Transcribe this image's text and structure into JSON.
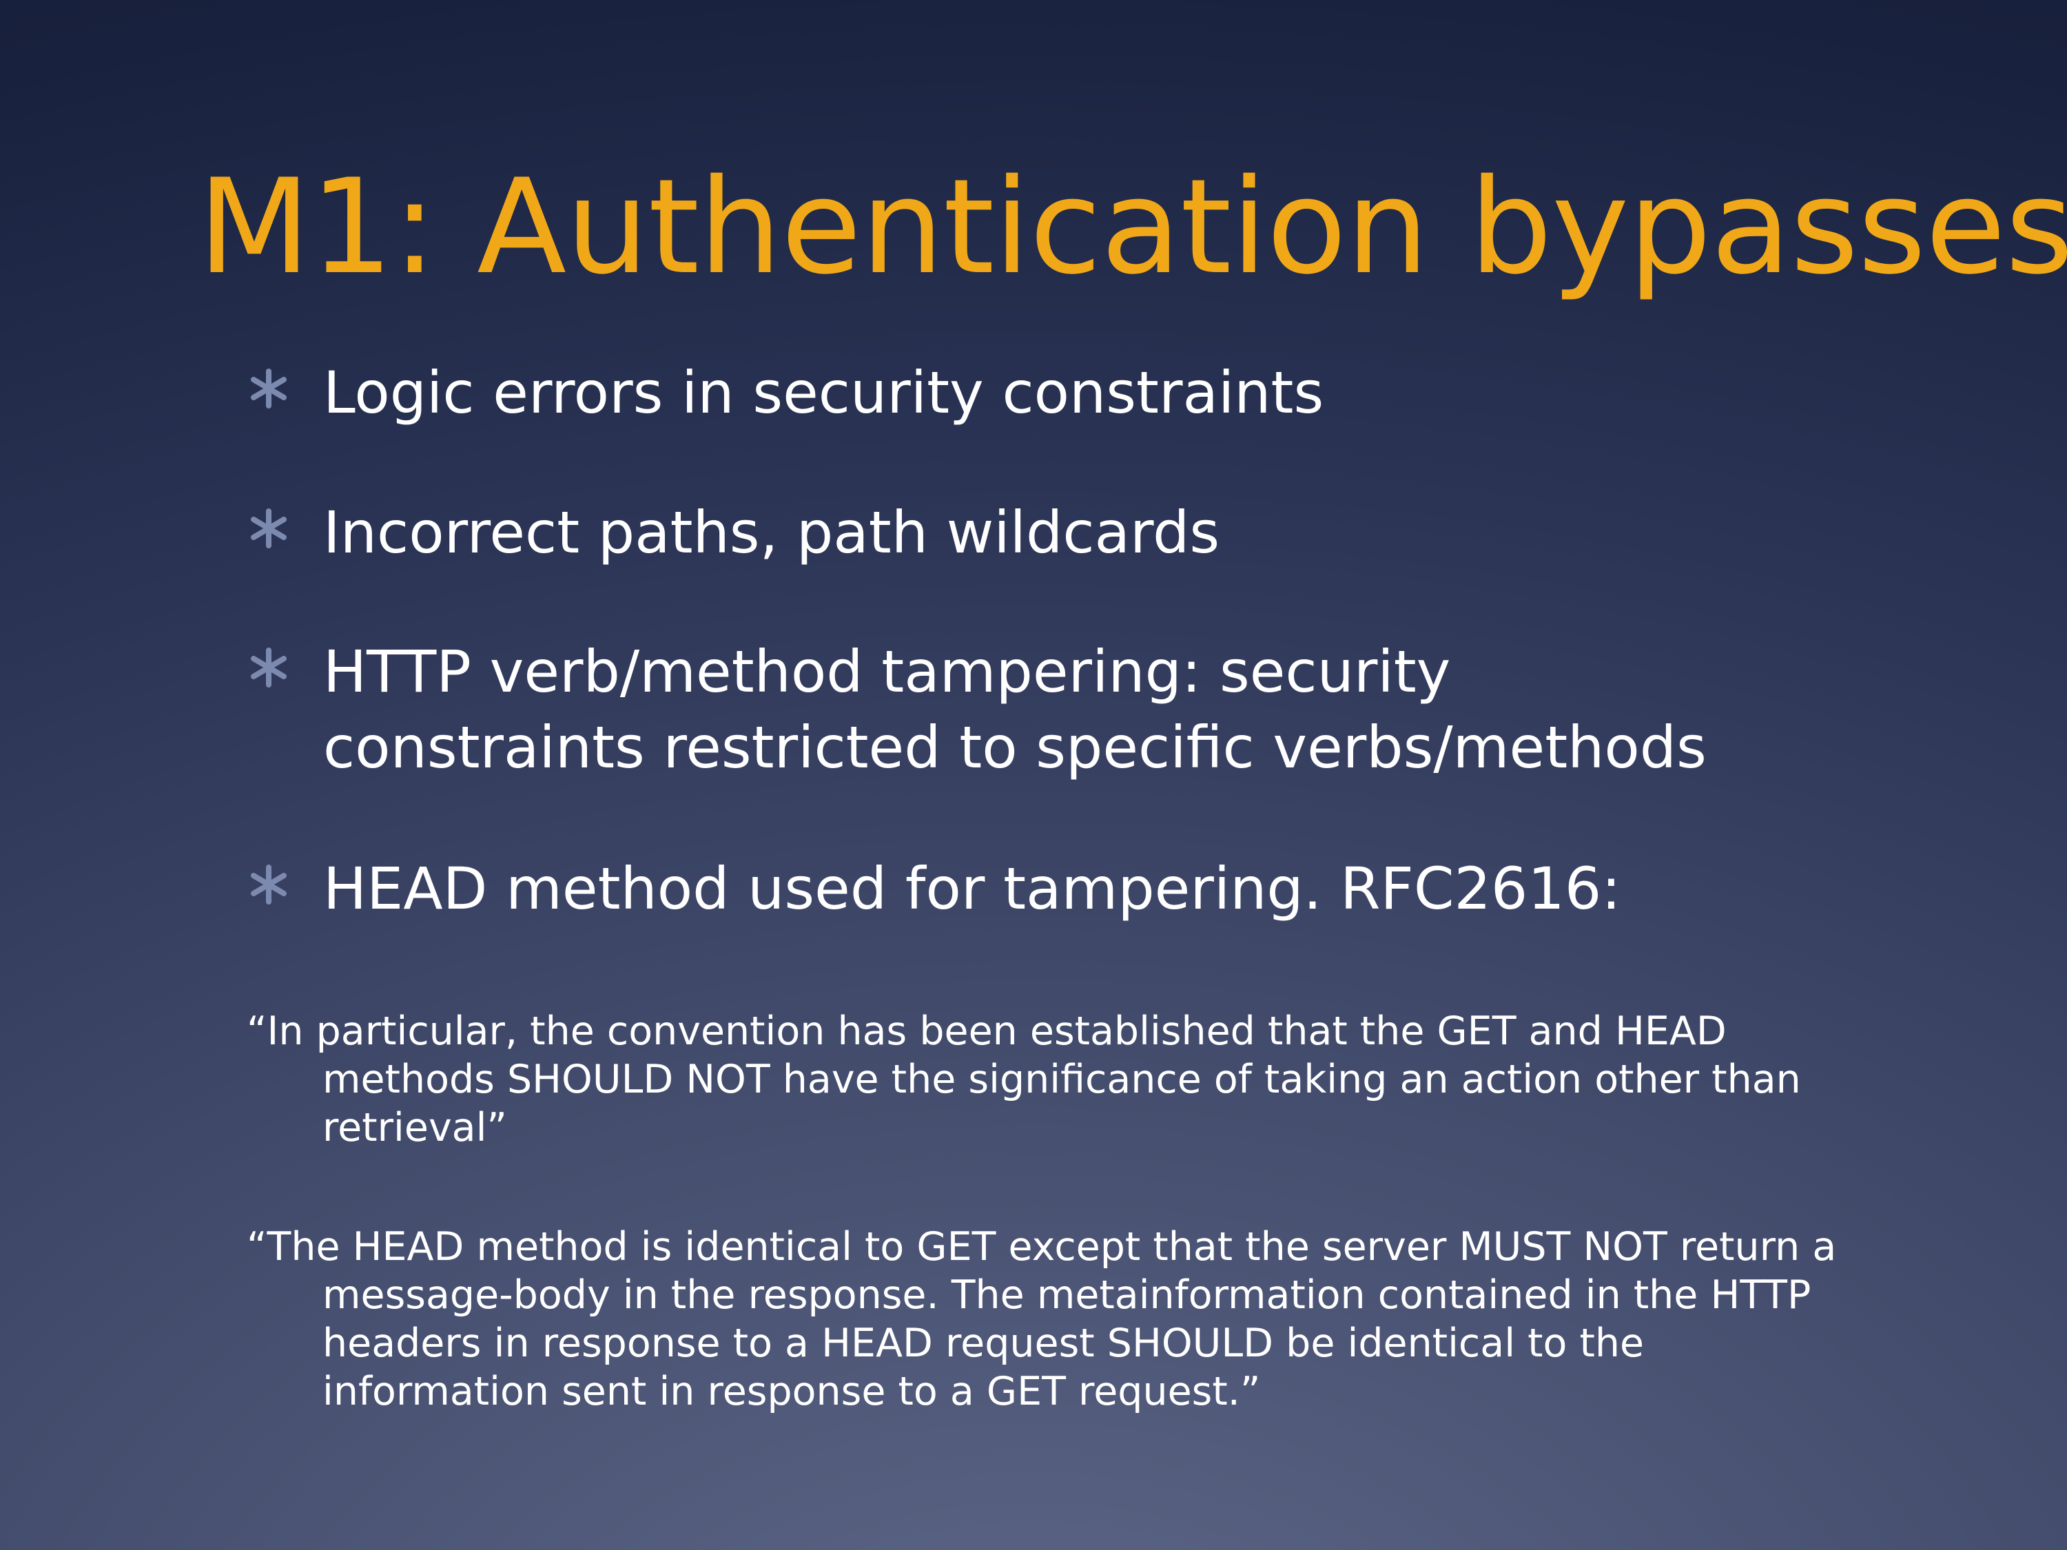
{
  "slide": {
    "title": "M1: Authentication bypasses",
    "bullet_icon": "asterisk-icon",
    "colors": {
      "title": "#f0a818",
      "text": "#ffffff",
      "bullet": "#7d8ab0",
      "background": "#1f2848"
    },
    "bullets": [
      {
        "text": "Logic errors in security constraints"
      },
      {
        "text": "Incorrect paths, path wildcards"
      },
      {
        "text": "HTTP verb/method tampering: security\nconstraints restricted to specific verbs/methods"
      },
      {
        "text": "HEAD method used for tampering. RFC2616:"
      }
    ],
    "quotes": [
      {
        "text": "“In particular, the convention has been established that the GET and HEAD methods SHOULD NOT have the significance of taking an action other than retrieval”"
      },
      {
        "text": "“The HEAD method is identical to GET except that the server MUST NOT return a message-body in the response. The metainformation contained in the HTTP headers in response to a HEAD request SHOULD be identical to the information sent in response to a GET request.”"
      }
    ]
  }
}
